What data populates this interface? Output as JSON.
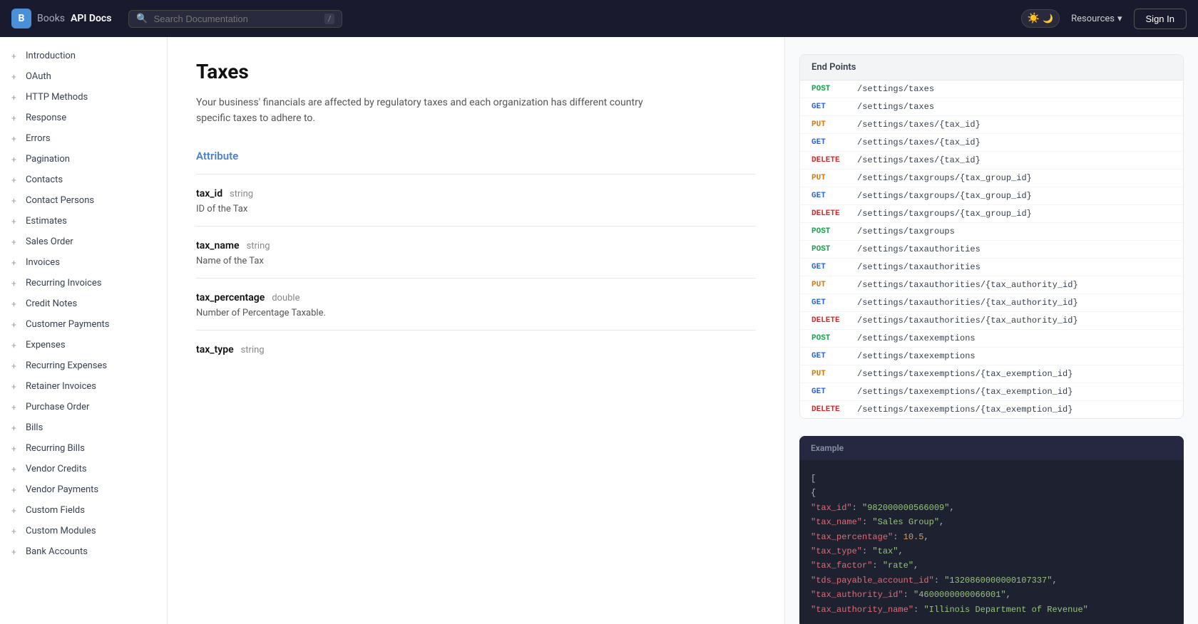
{
  "header": {
    "logo_letter": "B",
    "app_name": "Books",
    "title": "API Docs",
    "search_placeholder": "Search Documentation",
    "search_shortcut": "/",
    "resources_label": "Resources",
    "signin_label": "Sign In"
  },
  "sidebar": {
    "items": [
      {
        "id": "introduction",
        "label": "Introduction"
      },
      {
        "id": "oauth",
        "label": "OAuth"
      },
      {
        "id": "http-methods",
        "label": "HTTP Methods"
      },
      {
        "id": "response",
        "label": "Response"
      },
      {
        "id": "errors",
        "label": "Errors"
      },
      {
        "id": "pagination",
        "label": "Pagination"
      },
      {
        "id": "contacts",
        "label": "Contacts"
      },
      {
        "id": "contact-persons",
        "label": "Contact Persons"
      },
      {
        "id": "estimates",
        "label": "Estimates"
      },
      {
        "id": "sales-order",
        "label": "Sales Order"
      },
      {
        "id": "invoices",
        "label": "Invoices"
      },
      {
        "id": "recurring-invoices",
        "label": "Recurring Invoices"
      },
      {
        "id": "credit-notes",
        "label": "Credit Notes"
      },
      {
        "id": "customer-payments",
        "label": "Customer Payments"
      },
      {
        "id": "expenses",
        "label": "Expenses"
      },
      {
        "id": "recurring-expenses",
        "label": "Recurring Expenses"
      },
      {
        "id": "retainer-invoices",
        "label": "Retainer Invoices"
      },
      {
        "id": "purchase-order",
        "label": "Purchase Order"
      },
      {
        "id": "bills",
        "label": "Bills"
      },
      {
        "id": "recurring-bills",
        "label": "Recurring Bills"
      },
      {
        "id": "vendor-credits",
        "label": "Vendor Credits"
      },
      {
        "id": "vendor-payments",
        "label": "Vendor Payments"
      },
      {
        "id": "custom-fields",
        "label": "Custom Fields"
      },
      {
        "id": "custom-modules",
        "label": "Custom Modules"
      },
      {
        "id": "bank-accounts",
        "label": "Bank Accounts"
      }
    ]
  },
  "page": {
    "title": "Taxes",
    "description": "Your business' financials are affected by regulatory taxes and each organization has different country specific taxes to adhere to.",
    "attribute_header": "Attribute",
    "attributes": [
      {
        "name": "tax_id",
        "type": "string",
        "description": "ID of the Tax"
      },
      {
        "name": "tax_name",
        "type": "string",
        "description": "Name of the Tax"
      },
      {
        "name": "tax_percentage",
        "type": "double",
        "description": "Number of Percentage Taxable."
      },
      {
        "name": "tax_type",
        "type": "string",
        "description": ""
      }
    ]
  },
  "endpoints": {
    "header": "End Points",
    "items": [
      {
        "method": "POST",
        "path": "/settings/taxes"
      },
      {
        "method": "GET",
        "path": "/settings/taxes"
      },
      {
        "method": "PUT",
        "path": "/settings/taxes/{tax_id}"
      },
      {
        "method": "GET",
        "path": "/settings/taxes/{tax_id}"
      },
      {
        "method": "DELETE",
        "path": "/settings/taxes/{tax_id}"
      },
      {
        "method": "PUT",
        "path": "/settings/taxgroups/{tax_group_id}"
      },
      {
        "method": "GET",
        "path": "/settings/taxgroups/{tax_group_id}"
      },
      {
        "method": "DELETE",
        "path": "/settings/taxgroups/{tax_group_id}"
      },
      {
        "method": "POST",
        "path": "/settings/taxgroups"
      },
      {
        "method": "POST",
        "path": "/settings/taxauthorities"
      },
      {
        "method": "GET",
        "path": "/settings/taxauthorities"
      },
      {
        "method": "PUT",
        "path": "/settings/taxauthorities/{tax_authority_id}"
      },
      {
        "method": "GET",
        "path": "/settings/taxauthorities/{tax_authority_id}"
      },
      {
        "method": "DELETE",
        "path": "/settings/taxauthorities/{tax_authority_id}"
      },
      {
        "method": "POST",
        "path": "/settings/taxexemptions"
      },
      {
        "method": "GET",
        "path": "/settings/taxexemptions"
      },
      {
        "method": "PUT",
        "path": "/settings/taxexemptions/{tax_exemption_id}"
      },
      {
        "method": "GET",
        "path": "/settings/taxexemptions/{tax_exemption_id}"
      },
      {
        "method": "DELETE",
        "path": "/settings/taxexemptions/{tax_exemption_id}"
      }
    ]
  },
  "example": {
    "header": "Example",
    "code_lines": [
      {
        "indent": 0,
        "content": "[",
        "type": "bracket"
      },
      {
        "indent": 1,
        "content": "{",
        "type": "bracket"
      },
      {
        "indent": 2,
        "key": "tax_id",
        "value": "\"982000000566009\"",
        "value_type": "string"
      },
      {
        "indent": 2,
        "key": "tax_name",
        "value": "\"Sales Group\"",
        "value_type": "string"
      },
      {
        "indent": 2,
        "key": "tax_percentage",
        "value": "10.5",
        "value_type": "number"
      },
      {
        "indent": 2,
        "key": "tax_type",
        "value": "\"tax\"",
        "value_type": "string"
      },
      {
        "indent": 2,
        "key": "tax_factor",
        "value": "\"rate\"",
        "value_type": "string"
      },
      {
        "indent": 2,
        "key": "tds_payable_account_id",
        "value": "\"1320860000000107337\"",
        "value_type": "string"
      },
      {
        "indent": 2,
        "key": "tax_authority_id",
        "value": "\"4600000000066001\"",
        "value_type": "string"
      },
      {
        "indent": 2,
        "key": "tax_authority_name",
        "value": "\"Illinois Department of Revenue\"",
        "value_type": "string"
      }
    ]
  }
}
